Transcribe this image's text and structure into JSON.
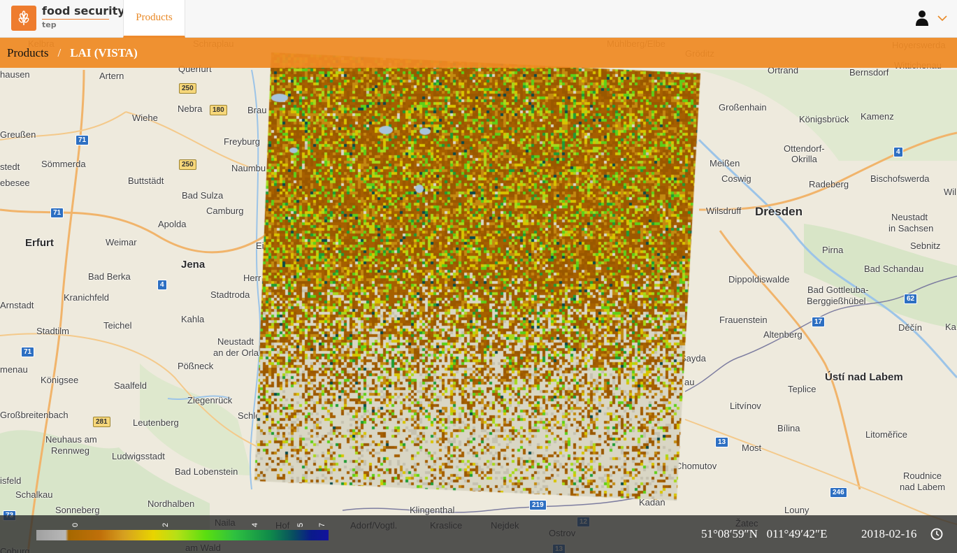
{
  "header": {
    "brand_name": "food security",
    "brand_sub": "tep",
    "nav_products": "Products",
    "logo_icon": "wheat-icon",
    "user_icon": "user-icon",
    "menu_icon": "chevron-down-icon",
    "accent_color": "#ee7c2e"
  },
  "breadcrumb": {
    "root": "Products",
    "separator": "/",
    "current": "LAI (VISTA)"
  },
  "map": {
    "labels": [
      {
        "text": "Kelbra",
        "cls": ""
      },
      {
        "text": "Schraplau",
        "cls": ""
      },
      {
        "text": "Mühlberg/Elbe",
        "cls": ""
      },
      {
        "text": "Gröditz",
        "cls": ""
      },
      {
        "text": "Hoyerswerda",
        "cls": ""
      },
      {
        "text": "Wittichenau",
        "cls": ""
      },
      {
        "text": "hausen",
        "cls": ""
      },
      {
        "text": "Artern",
        "cls": ""
      },
      {
        "text": "Querfurt",
        "cls": ""
      },
      {
        "text": "Ortrand",
        "cls": ""
      },
      {
        "text": "Bernsdorf",
        "cls": ""
      },
      {
        "text": "Nebra",
        "cls": ""
      },
      {
        "text": "Brau",
        "cls": ""
      },
      {
        "text": "Großenhain",
        "cls": ""
      },
      {
        "text": "Wiehe",
        "cls": ""
      },
      {
        "text": "Königsbrück",
        "cls": ""
      },
      {
        "text": "Kamenz",
        "cls": ""
      },
      {
        "text": "Greußen",
        "cls": ""
      },
      {
        "text": "Freyburg",
        "cls": ""
      },
      {
        "text": "Ottendorf-",
        "cls": ""
      },
      {
        "text": "Okrilla",
        "cls": ""
      },
      {
        "text": "stedt",
        "cls": ""
      },
      {
        "text": "Sömmerda",
        "cls": ""
      },
      {
        "text": "Naumbu",
        "cls": ""
      },
      {
        "text": "Meißen",
        "cls": ""
      },
      {
        "text": "ebesee",
        "cls": ""
      },
      {
        "text": "Buttstädt",
        "cls": ""
      },
      {
        "text": "Coswig",
        "cls": ""
      },
      {
        "text": "Radeberg",
        "cls": ""
      },
      {
        "text": "Bischofswerda",
        "cls": ""
      },
      {
        "text": "Bad Sulza",
        "cls": ""
      },
      {
        "text": "Wil",
        "cls": ""
      },
      {
        "text": "Camburg",
        "cls": ""
      },
      {
        "text": "Wilsdruff",
        "cls": ""
      },
      {
        "text": "Dresden",
        "cls": "city"
      },
      {
        "text": "Neustadt",
        "cls": ""
      },
      {
        "text": "in Sachsen",
        "cls": ""
      },
      {
        "text": "Apolda",
        "cls": ""
      },
      {
        "text": "Erfurt",
        "cls": "big"
      },
      {
        "text": "Weimar",
        "cls": ""
      },
      {
        "text": "Ei",
        "cls": ""
      },
      {
        "text": "Sebnitz",
        "cls": ""
      },
      {
        "text": "Pirna",
        "cls": ""
      },
      {
        "text": "Jena",
        "cls": "big"
      },
      {
        "text": "Bad Schandau",
        "cls": ""
      },
      {
        "text": "Bad Berka",
        "cls": ""
      },
      {
        "text": "Herr",
        "cls": ""
      },
      {
        "text": "Dippoldiswalde",
        "cls": ""
      },
      {
        "text": "Bad Gottleuba-",
        "cls": ""
      },
      {
        "text": "Berggießhübel",
        "cls": ""
      },
      {
        "text": "Arnstadt",
        "cls": ""
      },
      {
        "text": "Kranichfeld",
        "cls": ""
      },
      {
        "text": "Stadtroda",
        "cls": ""
      },
      {
        "text": "Kahla",
        "cls": ""
      },
      {
        "text": "Frauenstein",
        "cls": ""
      },
      {
        "text": "Teichel",
        "cls": ""
      },
      {
        "text": "Altenberg",
        "cls": ""
      },
      {
        "text": "Děčín",
        "cls": ""
      },
      {
        "text": "Ka",
        "cls": ""
      },
      {
        "text": "Stadtilm",
        "cls": ""
      },
      {
        "text": "Neustadt",
        "cls": ""
      },
      {
        "text": "an der Orla",
        "cls": ""
      },
      {
        "text": "Sayda",
        "cls": ""
      },
      {
        "text": "Pößneck",
        "cls": ""
      },
      {
        "text": "menau",
        "cls": ""
      },
      {
        "text": "Königsee",
        "cls": ""
      },
      {
        "text": "Saalfeld",
        "cls": ""
      },
      {
        "text": "Ústí nad Labem",
        "cls": "big"
      },
      {
        "text": "au",
        "cls": ""
      },
      {
        "text": "Teplice",
        "cls": ""
      },
      {
        "text": "Ziegenrück",
        "cls": ""
      },
      {
        "text": "Litvínov",
        "cls": ""
      },
      {
        "text": "Großbreitenbach",
        "cls": ""
      },
      {
        "text": "Schle",
        "cls": ""
      },
      {
        "text": "Leutenberg",
        "cls": ""
      },
      {
        "text": "Bílina",
        "cls": ""
      },
      {
        "text": "Litoměřice",
        "cls": ""
      },
      {
        "text": "Neuhaus am",
        "cls": ""
      },
      {
        "text": "Rennweg",
        "cls": ""
      },
      {
        "text": "Most",
        "cls": ""
      },
      {
        "text": "Ludwigsstadt",
        "cls": ""
      },
      {
        "text": "Chomutov",
        "cls": ""
      },
      {
        "text": "Bad Lobenstein",
        "cls": ""
      },
      {
        "text": "Roudnice",
        "cls": ""
      },
      {
        "text": "nad Labem",
        "cls": ""
      },
      {
        "text": "isfeld",
        "cls": ""
      },
      {
        "text": "Schalkau",
        "cls": ""
      },
      {
        "text": "Nordhalben",
        "cls": ""
      },
      {
        "text": "Kadaň",
        "cls": ""
      },
      {
        "text": "Sonneberg",
        "cls": ""
      },
      {
        "text": "Klingenthal",
        "cls": ""
      },
      {
        "text": "Louny",
        "cls": ""
      },
      {
        "text": "Naila",
        "cls": ""
      },
      {
        "text": "Hof",
        "cls": ""
      },
      {
        "text": "Adorf/Vogtl.",
        "cls": ""
      },
      {
        "text": "Kraslice",
        "cls": ""
      },
      {
        "text": "Nejdek",
        "cls": ""
      },
      {
        "text": "Žatec",
        "cls": ""
      },
      {
        "text": "Ostrov",
        "cls": ""
      },
      {
        "text": "Coburg",
        "cls": ""
      },
      {
        "text": "am Wald",
        "cls": ""
      }
    ],
    "shields": [
      {
        "text": "250",
        "cls": "y"
      },
      {
        "text": "180",
        "cls": "y"
      },
      {
        "text": "71",
        "cls": "b"
      },
      {
        "text": "250",
        "cls": "y"
      },
      {
        "text": "4",
        "cls": "b"
      },
      {
        "text": "71",
        "cls": "b"
      },
      {
        "text": "4",
        "cls": "b"
      },
      {
        "text": "62",
        "cls": "b"
      },
      {
        "text": "17",
        "cls": "b"
      },
      {
        "text": "71",
        "cls": "b"
      },
      {
        "text": "281",
        "cls": "y"
      },
      {
        "text": "13",
        "cls": "b"
      },
      {
        "text": "246",
        "cls": "b"
      },
      {
        "text": "219",
        "cls": "b"
      },
      {
        "text": "73",
        "cls": "b"
      },
      {
        "text": "12",
        "cls": "b"
      },
      {
        "text": "13",
        "cls": "b"
      }
    ]
  },
  "legend": {
    "ticks": [
      "0",
      "2",
      "4",
      "5",
      "7"
    ],
    "colors": [
      "#a0a0a0",
      "#a66800",
      "#e8d400",
      "#5ade10",
      "#0f8a4a",
      "#12139c"
    ]
  },
  "status": {
    "lat": "51°08′59″N",
    "lon": "011°49′42″E",
    "date": "2018-02-16",
    "date_icon": "clock-icon"
  }
}
